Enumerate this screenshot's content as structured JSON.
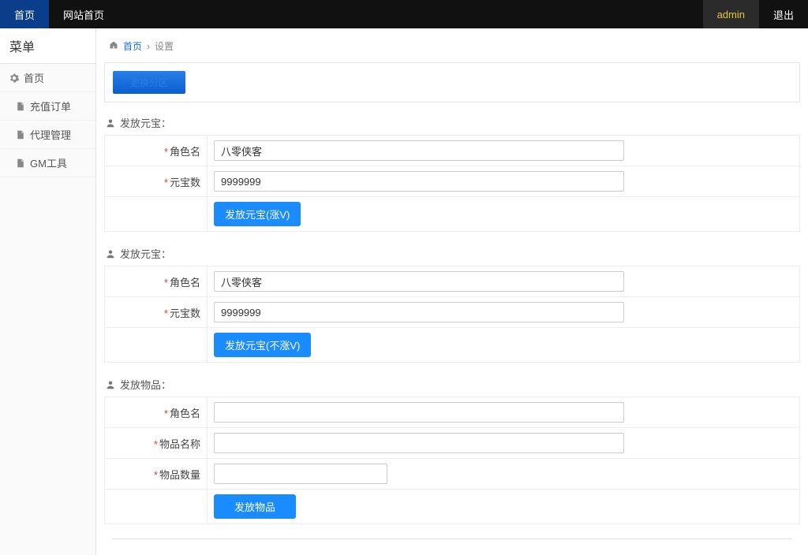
{
  "topbar": {
    "home": "首页",
    "siteHome": "网站首页",
    "user": "admin",
    "logout": "退出"
  },
  "sidebar": {
    "title": "菜单",
    "home": "首页",
    "items": [
      "充值订单",
      "代理管理",
      "GM工具"
    ]
  },
  "breadcrumb": {
    "home": "首页",
    "current": "设置"
  },
  "banner": {
    "label": "更换分区"
  },
  "sections": [
    {
      "title": "发放元宝：",
      "fields": [
        {
          "label": "角色名",
          "value": "八零侠客"
        },
        {
          "label": "元宝数",
          "value": "9999999"
        }
      ],
      "button": "发放元宝(涨V)"
    },
    {
      "title": "发放元宝：",
      "fields": [
        {
          "label": "角色名",
          "value": "八零侠客"
        },
        {
          "label": "元宝数",
          "value": "9999999"
        }
      ],
      "button": "发放元宝(不涨V)"
    },
    {
      "title": "发放物品：",
      "fields": [
        {
          "label": "角色名",
          "value": ""
        },
        {
          "label": "物品名称",
          "value": ""
        },
        {
          "label": "物品数量",
          "value": ""
        }
      ],
      "button": "发放物品"
    }
  ]
}
